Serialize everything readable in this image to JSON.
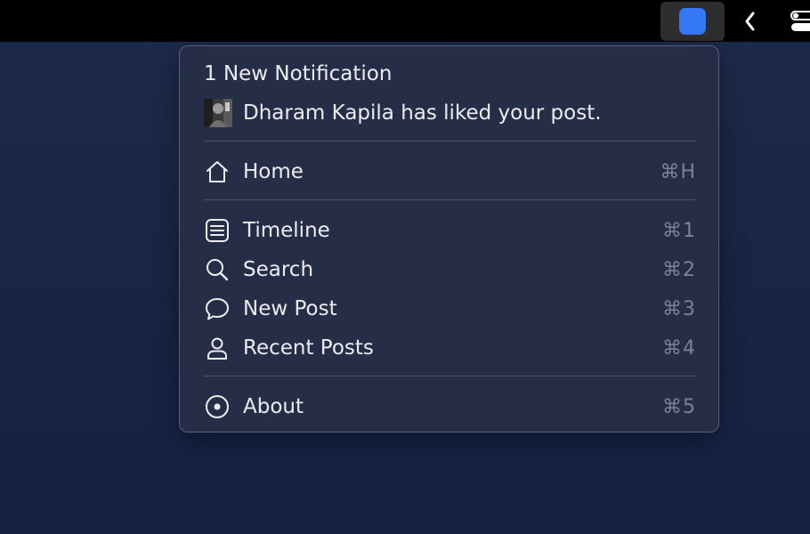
{
  "menubar": {
    "app_icon": "app-icon",
    "chevron_icon": "chevron-left-icon",
    "control_center_icon": "control-center-icon",
    "accent_color": "#3478f6"
  },
  "menu": {
    "notification_title": "1 New Notification",
    "notification_text": "Dharam Kapila has liked your post.",
    "items": [
      {
        "label": "Home",
        "shortcut": "⌘H",
        "icon": "home-icon"
      },
      {
        "label": "Timeline",
        "shortcut": "⌘1",
        "icon": "timeline-icon"
      },
      {
        "label": "Search",
        "shortcut": "⌘2",
        "icon": "search-icon"
      },
      {
        "label": "New Post",
        "shortcut": "⌘3",
        "icon": "speech-bubble-icon"
      },
      {
        "label": "Recent Posts",
        "shortcut": "⌘4",
        "icon": "person-icon"
      },
      {
        "label": "About",
        "shortcut": "⌘5",
        "icon": "about-icon"
      }
    ]
  }
}
